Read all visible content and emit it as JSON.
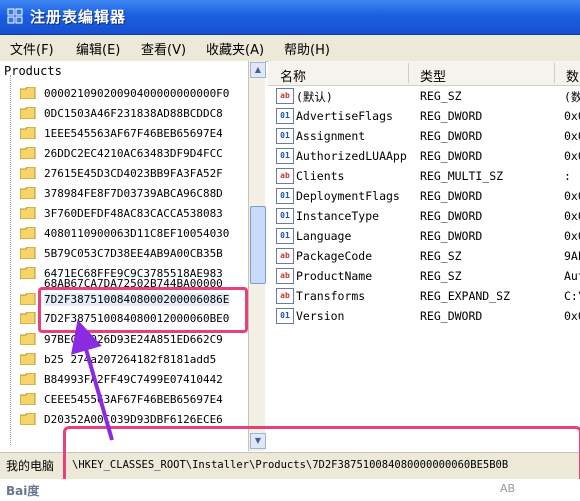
{
  "window": {
    "title": "注册表编辑器"
  },
  "menu": [
    {
      "label": "文件(F)"
    },
    {
      "label": "编辑(E)"
    },
    {
      "label": "查看(V)"
    },
    {
      "label": "收藏夹(A)"
    },
    {
      "label": "帮助(H)"
    }
  ],
  "tree": {
    "root_label": "Products",
    "items": [
      {
        "label": "00002109020090400000000000F0"
      },
      {
        "label": "0DC1503A46F231838AD88BCDDC8"
      },
      {
        "label": "1EEE545563AF67F46BEB65697E4"
      },
      {
        "label": "26DDC2EC4210AC63483DF9D4FCC"
      },
      {
        "label": "27615E45D3CD4023BB9FA3FA52F"
      },
      {
        "label": "378984FE8F7D03739ABCA96C88D"
      },
      {
        "label": "3F760DEFDF48AC83CACCA538083"
      },
      {
        "label": "4080110900063D11C8EF10054030"
      },
      {
        "label": "5B79C053C7D38EE4AB9A00CB35B"
      },
      {
        "label": "6471EC68FFE9C9C3785518AE983"
      },
      {
        "label": "68AB67CA7DA72502B744BA00000"
      },
      {
        "label": "7D2F38751008408000200006086E"
      },
      {
        "label": "7D2F387510084080012000060BE0"
      },
      {
        "label": "97BEC25026D93E24A851ED662C9"
      },
      {
        "label": "b25   274a207264182f8181add5"
      },
      {
        "label": "B84993FA2FF49C7499E07410442"
      },
      {
        "label": "CEEE545563AF67F46BEB65697E4"
      },
      {
        "label": "D20352A00C039D93DBF6126ECE6"
      }
    ]
  },
  "columns": {
    "name": "名称",
    "type": "类型",
    "data": "数"
  },
  "values": [
    {
      "name": "(默认)",
      "type": "REG_SZ",
      "data": "(数",
      "icon": "string-value-icon"
    },
    {
      "name": "AdvertiseFlags",
      "type": "REG_DWORD",
      "data": "0x0",
      "icon": "binary-value-icon"
    },
    {
      "name": "Assignment",
      "type": "REG_DWORD",
      "data": "0x0",
      "icon": "binary-value-icon"
    },
    {
      "name": "AuthorizedLUAApp",
      "type": "REG_DWORD",
      "data": "0x0",
      "icon": "binary-value-icon"
    },
    {
      "name": "Clients",
      "type": "REG_MULTI_SZ",
      "data": ":",
      "icon": "string-value-icon"
    },
    {
      "name": "DeploymentFlags",
      "type": "REG_DWORD",
      "data": "0x0",
      "icon": "binary-value-icon"
    },
    {
      "name": "InstanceType",
      "type": "REG_DWORD",
      "data": "0x0",
      "icon": "binary-value-icon"
    },
    {
      "name": "Language",
      "type": "REG_DWORD",
      "data": "0x0",
      "icon": "binary-value-icon"
    },
    {
      "name": "PackageCode",
      "type": "REG_SZ",
      "data": "9AE",
      "icon": "string-value-icon"
    },
    {
      "name": "ProductName",
      "type": "REG_SZ",
      "data": "Aut",
      "icon": "string-value-icon"
    },
    {
      "name": "Transforms",
      "type": "REG_EXPAND_SZ",
      "data": "C:\\",
      "icon": "string-value-icon"
    },
    {
      "name": "Version",
      "type": "REG_DWORD",
      "data": "0x0",
      "icon": "binary-value-icon"
    }
  ],
  "status": {
    "prefix": "我的电脑",
    "path": "\\HKEY_CLASSES_ROOT\\Installer\\Products\\7D2F387510084080000000060BE5B0B"
  },
  "watermark": {
    "left": "Bai度",
    "right": "AB"
  },
  "colors": {
    "highlight": "#e8407a",
    "arrow": "#8a2be2",
    "title_bar": "#1b5fe0"
  }
}
